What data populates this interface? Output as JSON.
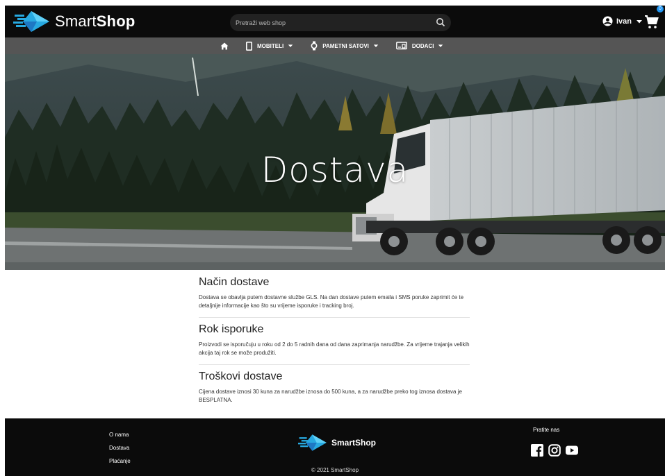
{
  "header": {
    "logo_text_light": "Smart",
    "logo_text_bold": "Shop",
    "search_placeholder": "Pretraži web shop",
    "user_name": "Ivan",
    "cart_count": "0"
  },
  "nav": {
    "items": [
      {
        "label": "MOBITELI",
        "icon": "phone-icon"
      },
      {
        "label": "PAMETNI SATOVI",
        "icon": "watch-icon"
      },
      {
        "label": "DODACI",
        "icon": "accessories-icon"
      }
    ]
  },
  "hero": {
    "title": "Dostava"
  },
  "sections": [
    {
      "title": "Način dostave",
      "text": "Dostava se obavlja putem dostavne službe GLS. Na dan dostave putem emaila i SMS poruke zaprimit će te detaljnije informacije kao što su vrijeme isporuke i tracking broj."
    },
    {
      "title": "Rok isporuke",
      "text": "Proizvodi se isporučuju u roku od 2 do 5 radnih dana od dana zaprimanja narudžbe. Za vrijeme trajanja velikih akcija taj rok se može produžiti."
    },
    {
      "title": "Troškovi dostave",
      "text": "Cijena dostave iznosi 30 kuna za narudžbe iznosa do 500 kuna, a za narudžbe preko tog iznosa dostava je BESPLATNA."
    }
  ],
  "footer": {
    "links": [
      "O nama",
      "Dostava",
      "Plaćanje"
    ],
    "logo_text": "SmartShop",
    "follow_label": "Pratite nas",
    "copyright": "© 2021 SmartShop",
    "socials": [
      "facebook-icon",
      "instagram-icon",
      "youtube-icon"
    ]
  },
  "colors": {
    "header_bg": "#0b0b0b",
    "nav_bg": "#555555",
    "accent": "#2196f3"
  }
}
